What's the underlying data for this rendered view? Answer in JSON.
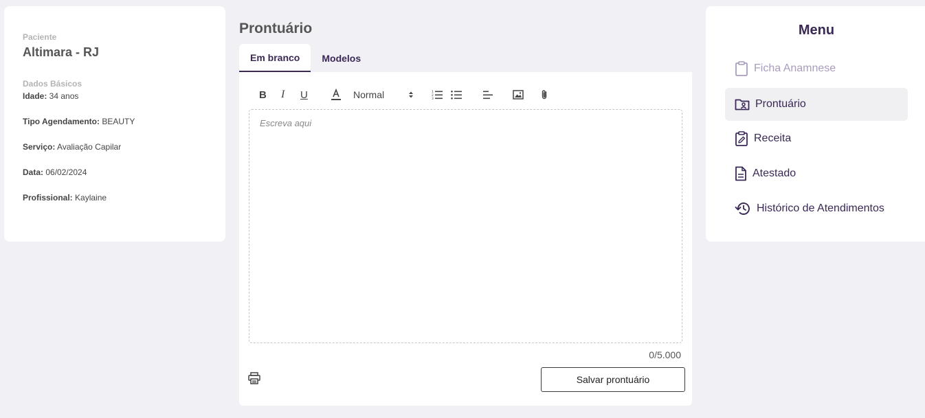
{
  "patient": {
    "label": "Paciente",
    "name": "Altimara - RJ",
    "section_label": "Dados Básicos",
    "fields": [
      {
        "label": "Idade:",
        "value": " 34 anos"
      },
      {
        "label": "Tipo Agendamento:",
        "value": " BEAUTY"
      },
      {
        "label": "Serviço:",
        "value": " Avaliação Capilar"
      },
      {
        "label": "Data:",
        "value": " 06/02/2024"
      },
      {
        "label": "Profissional:",
        "value": " Kaylaine"
      }
    ]
  },
  "center": {
    "title": "Prontuário",
    "tabs": [
      {
        "label": "Em branco",
        "active": true
      },
      {
        "label": "Modelos",
        "active": false
      }
    ],
    "toolbar": {
      "bold": "B",
      "italic": "I",
      "underline": "U",
      "size_value": "Normal",
      "icons": [
        "text-color-icon",
        "ordered-list-icon",
        "bullet-list-icon",
        "align-left-icon",
        "image-icon",
        "attach-icon"
      ]
    },
    "editor": {
      "placeholder": "Escreva aqui",
      "counter": "0/5.000"
    },
    "save_label": "Salvar prontuário"
  },
  "menu": {
    "title": "Menu",
    "items": [
      {
        "label": "Ficha Anamnese",
        "icon": "clipboard-icon",
        "state": "disabled"
      },
      {
        "label": "Prontuário",
        "icon": "folder-user-icon",
        "state": "active"
      },
      {
        "label": "Receita",
        "icon": "clipboard-edit-icon",
        "state": "normal"
      },
      {
        "label": "Atestado",
        "icon": "document-icon",
        "state": "normal"
      },
      {
        "label": "Histórico de Atendimentos",
        "icon": "history-icon",
        "state": "normal"
      }
    ]
  },
  "colors": {
    "primary": "#3a2855",
    "muted": "#a99cbc",
    "background": "#f1f1f5"
  }
}
